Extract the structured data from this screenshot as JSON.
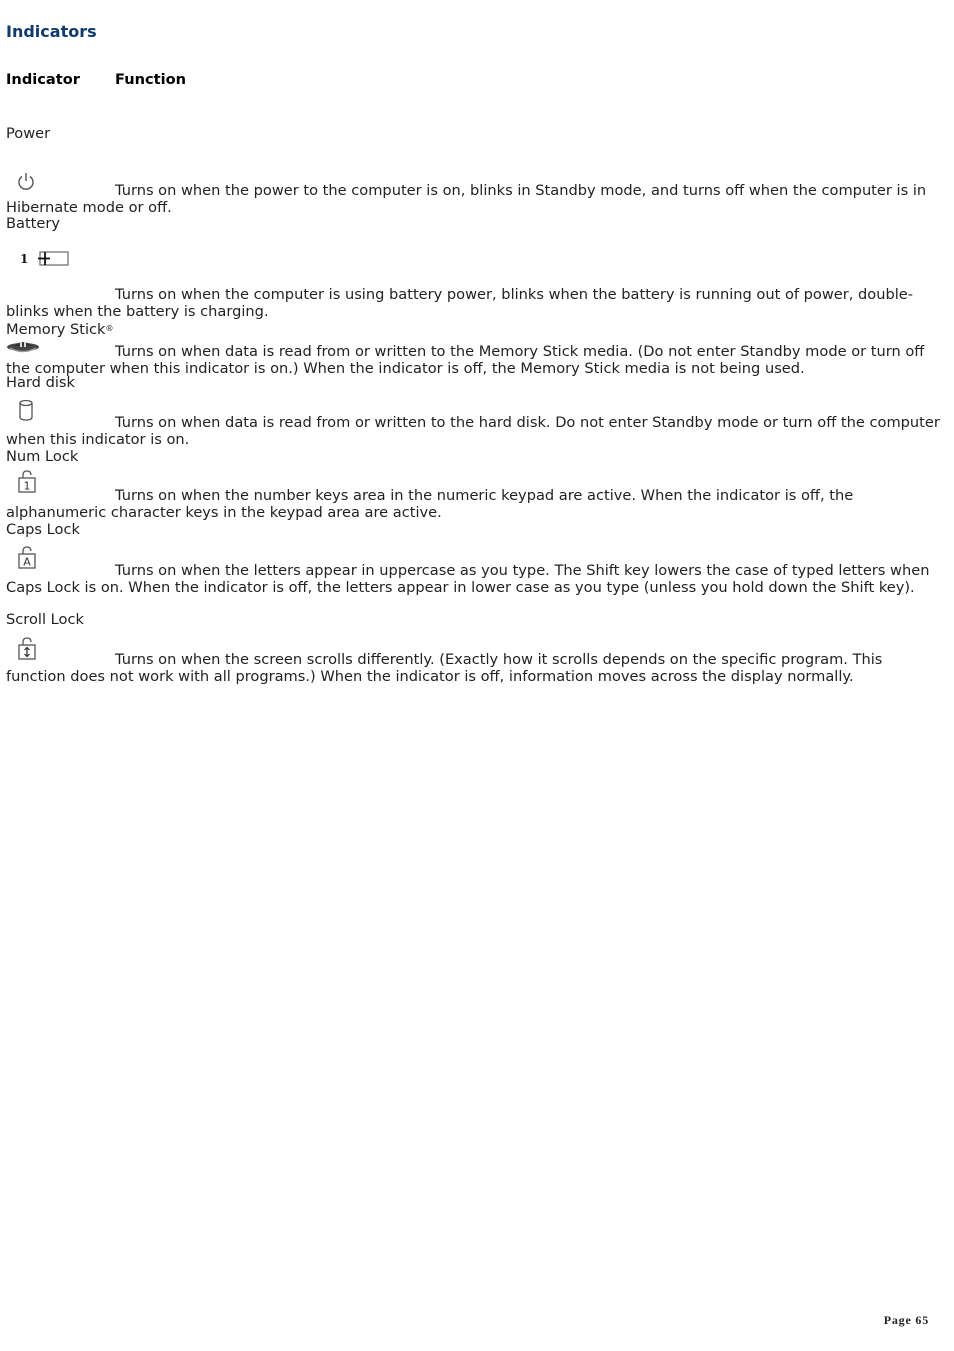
{
  "title": "Indicators",
  "table": {
    "headers": {
      "indicator": "Indicator",
      "function": "Function"
    },
    "rows": [
      {
        "name": "Power",
        "icon": "power-icon",
        "description": "Turns on when the power to the computer is on, blinks in Standby mode, and turns off when the computer is in Hibernate mode or off."
      },
      {
        "name": "Battery",
        "icon": "battery-icon",
        "icon_label": "1",
        "description": "Turns on when the computer is using battery power, blinks when the battery is running out of power, double-blinks when the battery is charging."
      },
      {
        "name": "Memory Stick",
        "name_suffix": "®",
        "icon": "memory-stick-icon",
        "description": "Turns on when data is read from or written to the Memory Stick media. (Do not enter Standby mode or turn off the computer when this indicator is on.) When the indicator is off, the Memory Stick media is not being used."
      },
      {
        "name": "Hard disk",
        "icon": "hard-disk-icon",
        "description": "Turns on when data is read from or written to the hard disk. Do not enter Standby mode or turn off the computer when this indicator is on."
      },
      {
        "name": "Num Lock",
        "icon": "num-lock-icon",
        "icon_label": "1",
        "description": "Turns on when the number keys area in the numeric keypad are active. When the indicator is off, the alphanumeric character keys in the keypad area are active."
      },
      {
        "name": "Caps Lock",
        "icon": "caps-lock-icon",
        "icon_label": "A",
        "description": "Turns on when the letters appear in uppercase as you type. The Shift key lowers the case of typed letters when Caps Lock is on. When the indicator is off, the letters appear in lower case as you type (unless you hold down the Shift key)."
      },
      {
        "name": "Scroll Lock",
        "icon": "scroll-lock-icon",
        "description": "Turns on when the screen scrolls differently. (Exactly how it scrolls depends on the specific program. This function does not work with all programs.) When the indicator is off, information moves across the display normally."
      }
    ]
  },
  "footer": {
    "page_label": "Page 65"
  },
  "colors": {
    "title": "#0f3a6e",
    "text": "#222222"
  }
}
